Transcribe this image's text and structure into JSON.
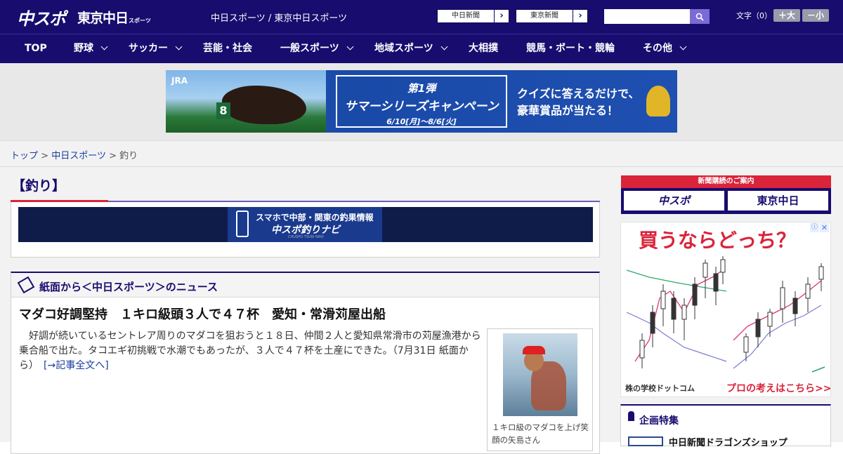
{
  "header": {
    "logo_chuspo": "中スポ",
    "logo_tokyo": "東京中日",
    "logo_tokyo_sub": "スポーツ",
    "site_title": "中日スポーツ / 東京中日スポーツ",
    "paper_links": [
      "中日新聞",
      "東京新聞"
    ],
    "search_placeholder": "",
    "font_label": "文字（0）",
    "font_larger": "＋大",
    "font_smaller": "－小"
  },
  "nav": {
    "items": [
      {
        "label": "TOP",
        "dropdown": false
      },
      {
        "label": "野球",
        "dropdown": true
      },
      {
        "label": "サッカー",
        "dropdown": true
      },
      {
        "label": "芸能・社会",
        "dropdown": false
      },
      {
        "label": "一般スポーツ",
        "dropdown": true
      },
      {
        "label": "地域スポーツ",
        "dropdown": true
      },
      {
        "label": "大相撲",
        "dropdown": false
      },
      {
        "label": "競馬・ボート・競輪",
        "dropdown": false
      },
      {
        "label": "その他",
        "dropdown": true
      }
    ]
  },
  "top_ad": {
    "logo": "JRA",
    "horse_number": "8",
    "line1": "第1弾",
    "line2": "サマーシリーズキャンペーン",
    "line3": "6/10[月]～8/6[火]",
    "quiz_line1": "クイズに答えるだけで、",
    "quiz_line2": "豪華賞品が当たる！"
  },
  "breadcrumb": {
    "home": "トップ",
    "section": "中日スポーツ",
    "current": "釣り",
    "separator": ">"
  },
  "page": {
    "heading": "【釣り】"
  },
  "tsuri_banner": {
    "line1": "スマホで中部・関東の釣果情報",
    "line2": "中スポ釣りナビ",
    "line3": "CHUSPO TSURI NAVI"
  },
  "news": {
    "section_title": "紙面から＜中日スポーツ＞のニュース",
    "article_title": "マダコ好調堅持　１キロ級頭３人で４７杯　愛知・常滑苅屋出船",
    "article_body": "　好調が続いているセントレア周りのマダコを狙おうと１８日、仲間２人と愛知県常滑市の苅屋漁港から乗合船で出た。タコエギ初挑戦で水潮でもあったが、３人で４７杯を土産にできた。（7月31日 紙面から）　",
    "read_more": "[→記事全文へ]",
    "photo_caption": "１キロ級のマダコを上げ笑顔の矢島さん"
  },
  "sidebar": {
    "subscribe_header": "新聞購読のご案内",
    "subscribe_chuspo": "中スポ",
    "subscribe_tokyo": "東京中日",
    "ad_title": "買うならどっち？",
    "ad_footer_logo": "株の学校ドットコム",
    "ad_footer_cta": "プロの考えはこちら>>>",
    "ad_close": "✕",
    "ad_info": "ⓘ",
    "kikaku_title": "企画特集",
    "kikaku_item": "中日新聞ドラゴンズショップ"
  },
  "colors": {
    "brand_navy": "#180c6e",
    "accent_red": "#d9243a",
    "link_blue": "#1a3d9e"
  }
}
